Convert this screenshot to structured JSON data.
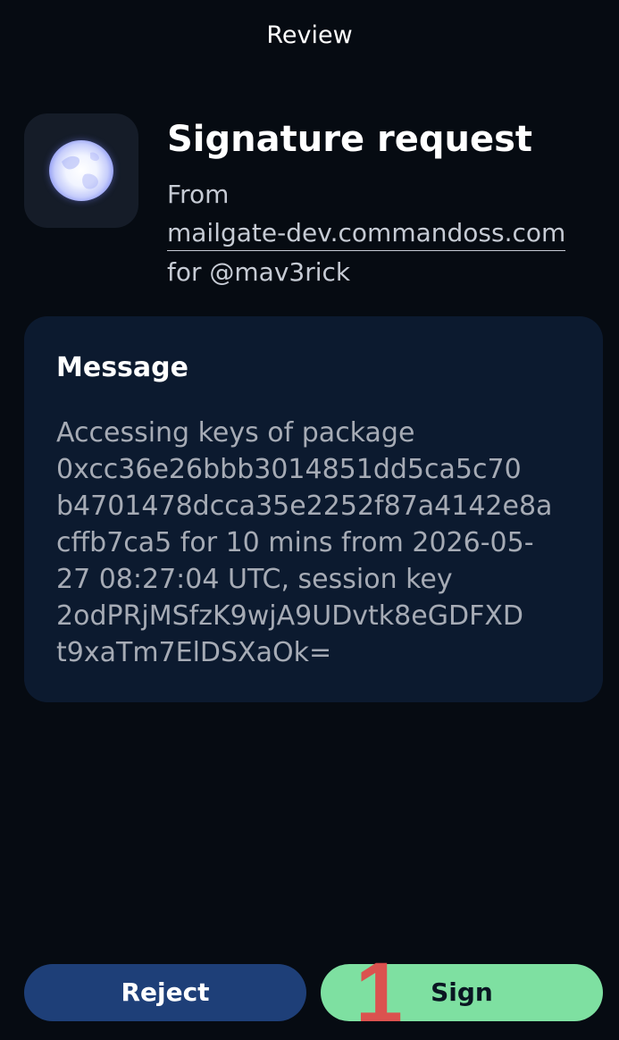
{
  "header": {
    "title": "Review"
  },
  "request": {
    "title": "Signature request",
    "from_label": "From",
    "origin": "mailgate-dev.commandoss.com",
    "for_user": "for @mav3rick",
    "app_icon": "globe-icon"
  },
  "message": {
    "heading": "Message",
    "body": "Accessing keys of package\n0xcc36e26bbb3014851dd5ca5c70\nb4701478dcca35e2252f87a4142e8a\ncffb7ca5 for 10 mins from 2026-05-\n27 08:27:04 UTC, session key\n2odPRjMSfzK9wjA9UDvtk8eGDFXD\nt9xaTm7ElDSXaOk="
  },
  "actions": {
    "reject_label": "Reject",
    "sign_label": "Sign"
  },
  "overlay": {
    "marker_label": "1"
  },
  "colors": {
    "background": "#060b12",
    "card": "#0c1a2f",
    "reject": "#1e3f78",
    "sign": "#7ee0a1",
    "marker": "#e14b4b"
  }
}
